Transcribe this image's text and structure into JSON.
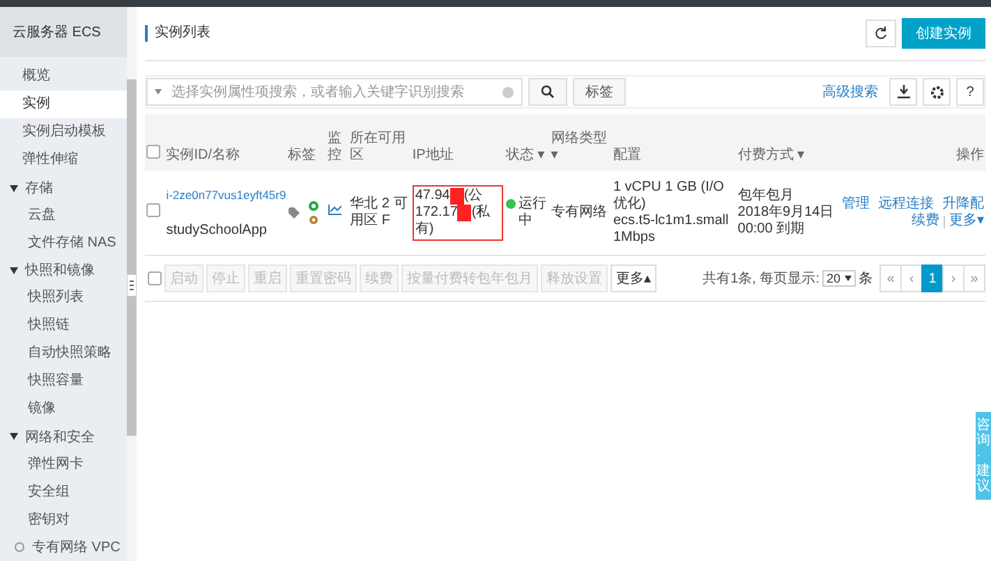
{
  "sidebar": {
    "title": "云服务器 ECS",
    "items": [
      {
        "label": "概览",
        "selected": false
      },
      {
        "label": "实例",
        "selected": true
      },
      {
        "label": "实例启动模板",
        "selected": false
      },
      {
        "label": "弹性伸缩",
        "selected": false
      },
      {
        "label": "存储",
        "expanded": true,
        "children": [
          {
            "label": "云盘",
            "selected": false
          },
          {
            "label": "文件存储 NAS",
            "selected": false
          }
        ]
      },
      {
        "label": "快照和镜像",
        "expanded": true,
        "children": [
          {
            "label": "快照列表",
            "selected": false
          },
          {
            "label": "快照链",
            "selected": false
          },
          {
            "label": "自动快照策略",
            "selected": false
          },
          {
            "label": "快照容量",
            "selected": false
          },
          {
            "label": "镜像",
            "selected": false
          }
        ]
      },
      {
        "label": "网络和安全",
        "expanded": true,
        "children": [
          {
            "label": "弹性网卡",
            "selected": false
          },
          {
            "label": "安全组",
            "selected": false
          },
          {
            "label": "密钥对",
            "selected": false
          }
        ]
      },
      {
        "label": "专有网络 VPC",
        "kind": "link"
      }
    ]
  },
  "header": {
    "title": "实例列表",
    "create_button": "创建实例"
  },
  "toolbar": {
    "search": {
      "placeholder": "选择实例属性项搜索，或者输入关键字识别搜索"
    },
    "tag_button": "标签",
    "advanced_search": "高级搜索",
    "help": "?"
  },
  "table": {
    "header_checked": false,
    "columns": [
      "实例ID/名称",
      "标签",
      "监控",
      "所在可用区",
      "IP地址",
      "状态 ▾",
      "网络类型 ▾",
      "配置",
      "付费方式 ▾",
      "操作"
    ],
    "rows": [
      {
        "checked": false,
        "id": "i-2ze0n77vus1eyft45r9",
        "name": "studySchoolApp",
        "zone": "华北 2 可用区 F",
        "ip_lines": [
          {
            "prefix": "47.94",
            "suffix": "(公"
          },
          {
            "prefix": "172.17",
            "suffix": "(私"
          }
        ],
        "ip_tail": "有)",
        "status": "运行中",
        "network": "专有网络",
        "config": [
          "1 vCPU 1 GB (I/O优化)",
          "ecs.t5-lc1m1.small",
          "1Mbps"
        ],
        "payment": [
          "包年包月",
          "2018年9月14日 00:00 到期"
        ],
        "actions": [
          [
            "管理",
            "远程连接",
            "升降配"
          ],
          [
            "续费",
            "更多▾"
          ]
        ]
      }
    ]
  },
  "footer": {
    "checked": false,
    "buttons": [
      {
        "label": "启动",
        "disabled": true
      },
      {
        "label": "停止",
        "disabled": true
      },
      {
        "label": "重启",
        "disabled": true
      },
      {
        "label": "重置密码",
        "disabled": true
      },
      {
        "label": "续费",
        "disabled": true
      },
      {
        "label": "按量付费转包年包月",
        "disabled": true
      },
      {
        "label": "释放设置",
        "disabled": true
      },
      {
        "label": "更多▴",
        "disabled": false
      }
    ],
    "summary": "共有1条, 每页显示:",
    "page_size": "20",
    "unit": "条",
    "pages": [
      {
        "label": "«",
        "selected": false
      },
      {
        "label": "‹",
        "selected": false
      },
      {
        "label": "1",
        "selected": true
      },
      {
        "label": "›",
        "selected": false
      },
      {
        "label": "»",
        "selected": false
      }
    ]
  },
  "feedback_tab": "咨询·建议"
}
